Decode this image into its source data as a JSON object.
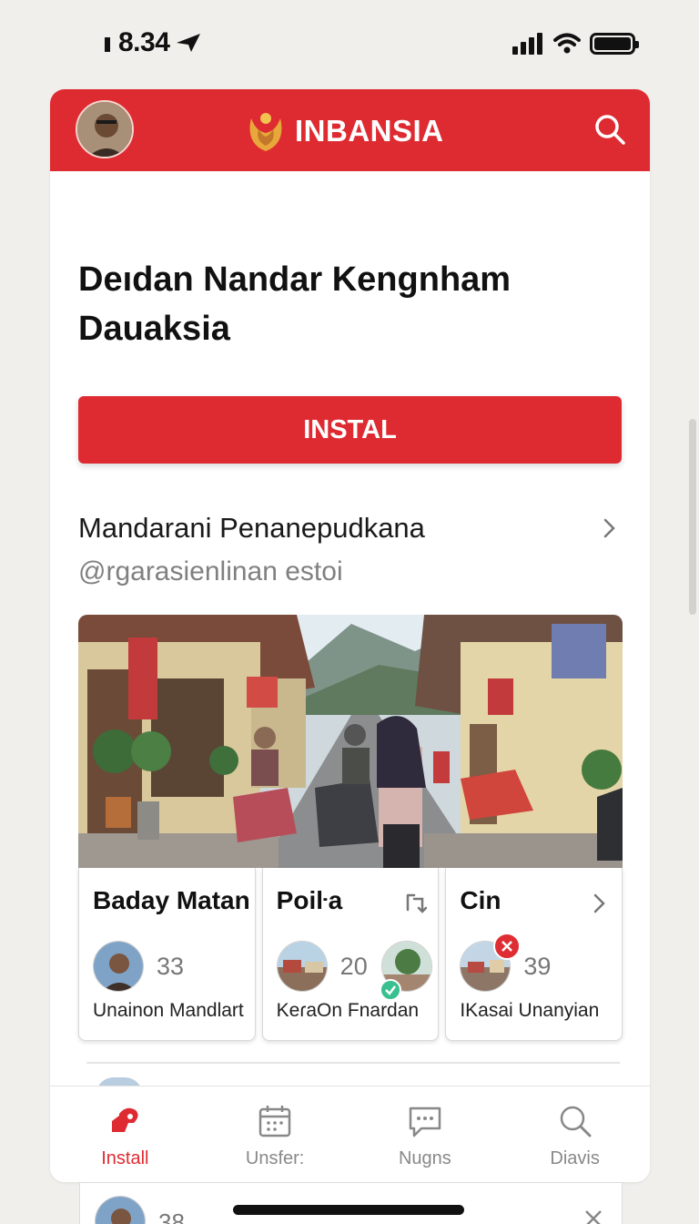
{
  "status_bar": {
    "time": "8.34"
  },
  "header": {
    "brand": "INBANSIA"
  },
  "page": {
    "title": "Deıdan Nandar Kengnham Dauaksia",
    "install_label": "INSTAL"
  },
  "section": {
    "title": "Mandarani Penanepudkana",
    "subtitle": "@rgarasienlinan estoi"
  },
  "cards": [
    {
      "title": "Baday Matan",
      "count": "33",
      "footer": "Unainon Mandlart"
    },
    {
      "title": "Poiŀa",
      "count": "20",
      "footer": "KeɾaOn Fnardan"
    },
    {
      "title": "Cin",
      "count": "39",
      "footer": "IKasai Unanyian"
    }
  ],
  "under_card": {
    "count": "38"
  },
  "nav": [
    {
      "label": "Install",
      "icon": "install-icon",
      "active": true
    },
    {
      "label": "Unsfer:",
      "icon": "calendar-icon",
      "active": false
    },
    {
      "label": "Nugns",
      "icon": "chat-icon",
      "active": false
    },
    {
      "label": "Diavis",
      "icon": "search-icon",
      "active": false
    }
  ],
  "colors": {
    "accent": "#de2b31",
    "check": "#38c08f"
  }
}
